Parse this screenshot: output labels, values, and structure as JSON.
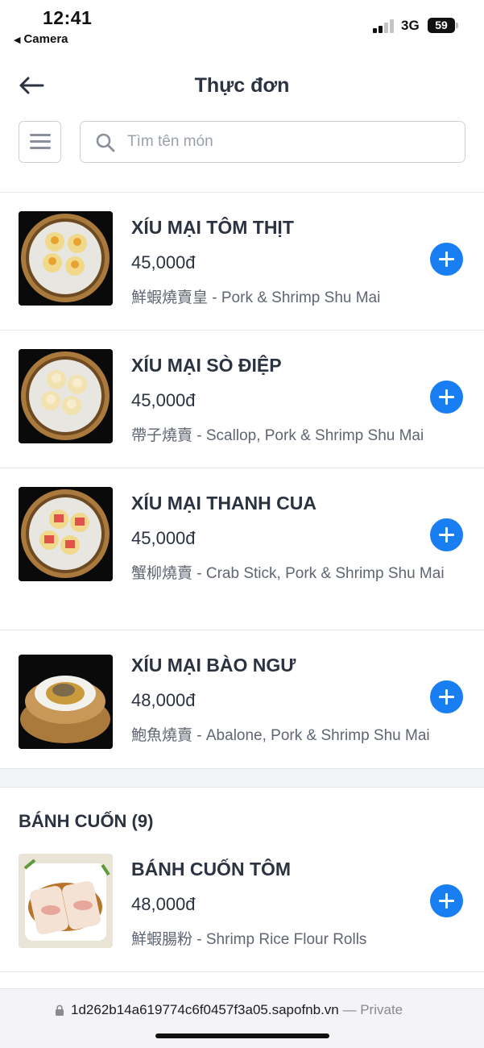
{
  "status_bar": {
    "time": "12:41",
    "back_app_label": "Camera",
    "network": "3G",
    "battery": "59"
  },
  "header": {
    "title": "Thực đơn"
  },
  "search": {
    "placeholder": "Tìm tên món",
    "value": ""
  },
  "items_group_1": [
    {
      "name": "XÍU MẠI TÔM THỊT",
      "price": "45,000đ",
      "description": "鮮蝦燒賣皇 - Pork & Shrimp Shu Mai"
    },
    {
      "name": "XÍU MẠI SÒ ĐIỆP",
      "price": "45,000đ",
      "description": "帶子燒賣 - Scallop, Pork & Shrimp Shu Mai"
    },
    {
      "name": "XÍU MẠI THANH CUA",
      "price": "45,000đ",
      "description": "蟹柳燒賣 - Crab Stick, Pork & Shrimp Shu Mai"
    },
    {
      "name": "XÍU MẠI BÀO NGƯ",
      "price": "48,000đ",
      "description": "鮑魚燒賣 - Abalone, Pork & Shrimp Shu Mai"
    }
  ],
  "category": {
    "title": "BÁNH CUỐN (9)"
  },
  "items_group_2": [
    {
      "name": "BÁNH CUỐN TÔM",
      "price": "48,000đ",
      "description": "鮮蝦腸粉 - Shrimp Rice Flour Rolls"
    }
  ],
  "url_bar": {
    "url": "1d262b14a619774c6f0457f3a05.sapofnb.vn",
    "privacy": " — Private"
  },
  "colors": {
    "accent": "#1a7ef3",
    "text": "#2b3341",
    "muted": "#5f6672"
  },
  "icons": {
    "back": "arrow-left-icon",
    "menu": "hamburger-icon",
    "search": "search-icon",
    "add": "plus-icon",
    "lock": "lock-icon"
  }
}
